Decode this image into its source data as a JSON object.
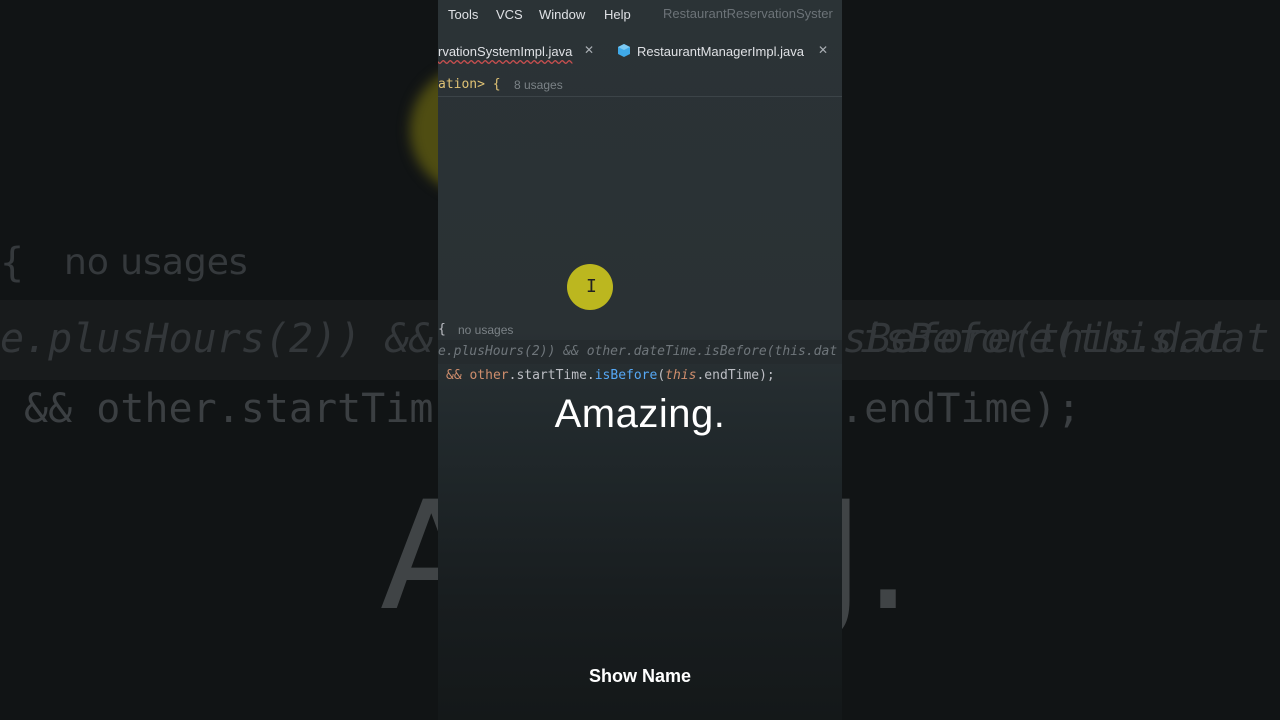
{
  "background": {
    "hint_text": "no usages",
    "brace": "{",
    "code_line1": "e.plusHours(2))  && other.dateTime.isBefore(this.dat",
    "code_line1_right": "isBefore(this.dat",
    "code_line2": "&& other.startTim",
    "code_line2_right": ".endTime);",
    "big_caption_left": "A",
    "big_caption_right": "J."
  },
  "menubar": {
    "items": [
      "Tools",
      "VCS",
      "Window",
      "Help"
    ],
    "project_title": "RestaurantReservationSyster"
  },
  "tabs": [
    {
      "label": "rvationSystemImpl.java",
      "icon": "java-class-icon"
    },
    {
      "label": "RestaurantManagerImpl.java",
      "icon": "java-class-icon"
    }
  ],
  "editor": {
    "line_class_tail": "ation> {",
    "line_class_usages": "8 usages",
    "method_brace": "{",
    "method_usages": "no usages",
    "ghost_line": "e.plusHours(2)) && other.dateTime.isBefore(this.dat",
    "code_and": "&&",
    "code_other": "other",
    "code_dot1": ".startTime.",
    "code_isBefore": "isBefore",
    "code_paren": "(",
    "code_this": "this",
    "code_end": ".endTime);"
  },
  "caption": {
    "main": "Amazing.",
    "show_name": "Show Name"
  },
  "colors": {
    "cursor_highlight": "#c9c21d",
    "keyword": "#cf8e6d",
    "method": "#56a8f5"
  }
}
